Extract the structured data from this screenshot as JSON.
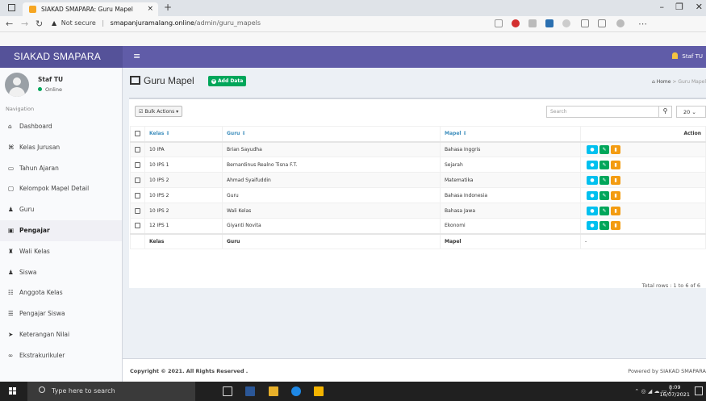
{
  "browser": {
    "tab_title": "SIAKAD SMAPARA: Guru Mapel",
    "tab_close": "×",
    "new_tab": "+",
    "security": "Not secure",
    "url_host": "smapanjuramalang.online",
    "url_path": "/admin/guru_mapels",
    "win_min": "–",
    "win_max": "❐",
    "win_close": "✕"
  },
  "header": {
    "brand": "SIAKAD SMAPARA",
    "menu_toggle": "≡",
    "user": "Staf TU"
  },
  "sidebar": {
    "user_name": "Staf TU",
    "user_status": "Online",
    "nav_header": "Navigation",
    "items": [
      {
        "icon": "⌂",
        "label": "Dashboard"
      },
      {
        "icon": "⌘",
        "label": "Kelas Jurusan"
      },
      {
        "icon": "▭",
        "label": "Tahun Ajaran"
      },
      {
        "icon": "▢",
        "label": "Kelompok Mapel Detail"
      },
      {
        "icon": "♟",
        "label": "Guru"
      },
      {
        "icon": "▣",
        "label": "Pengajar"
      },
      {
        "icon": "♜",
        "label": "Wali Kelas"
      },
      {
        "icon": "♟",
        "label": "Siswa"
      },
      {
        "icon": "☷",
        "label": "Anggota Kelas"
      },
      {
        "icon": "☰",
        "label": "Pengajar Siswa"
      },
      {
        "icon": "➤",
        "label": "Keterangan Nilai"
      },
      {
        "icon": "∞",
        "label": "Ekstrakurikuler"
      }
    ]
  },
  "page": {
    "title": "Guru Mapel",
    "add_button": "Add Data",
    "breadcrumb_home": "Home",
    "breadcrumb_sep": ">",
    "breadcrumb_current": "Guru Mapel"
  },
  "toolbar": {
    "bulk_actions": "Bulk Actions",
    "search_placeholder": "Search",
    "page_size": "20"
  },
  "table": {
    "headers": {
      "kelas": "Kelas ⇕",
      "guru": "Guru ⇕",
      "mapel": "Mapel ⇕",
      "action": "Action"
    },
    "rows": [
      {
        "kelas": "10 IPA",
        "guru": "Brian Sayudha",
        "mapel": "Bahasa Inggris"
      },
      {
        "kelas": "10 IPS 1",
        "guru": "Bernardinus Realno Tisna F.T.",
        "mapel": "Sejarah"
      },
      {
        "kelas": "10 IPS 2",
        "guru": "Ahmad Syaifuddin",
        "mapel": "Matematika"
      },
      {
        "kelas": "10 IPS 2",
        "guru": "Guru",
        "mapel": "Bahasa Indonesia"
      },
      {
        "kelas": "10 IPS 2",
        "guru": "Wali Kelas",
        "mapel": "Bahasa Jawa"
      },
      {
        "kelas": "12 IPS 1",
        "guru": "Giyanti Novita",
        "mapel": "Ekonomi"
      }
    ],
    "footer": {
      "kelas": "Kelas",
      "guru": "Guru",
      "mapel": "Mapel",
      "action": "-"
    },
    "total": "Total rows : 1 to 6 of 6"
  },
  "footer": {
    "copyright": "Copyright © 2021. All Rights Reserved .",
    "powered": "Powered by SIAKAD SMAPARA"
  },
  "taskbar": {
    "search": "Type here to search",
    "time": "8:09",
    "date": "16/07/2021"
  },
  "colors": {
    "header": "#605ca8",
    "brand": "#555299",
    "add": "#00a65a",
    "view": "#00c0ef",
    "edit": "#00a65a",
    "delete": "#f39c12"
  }
}
